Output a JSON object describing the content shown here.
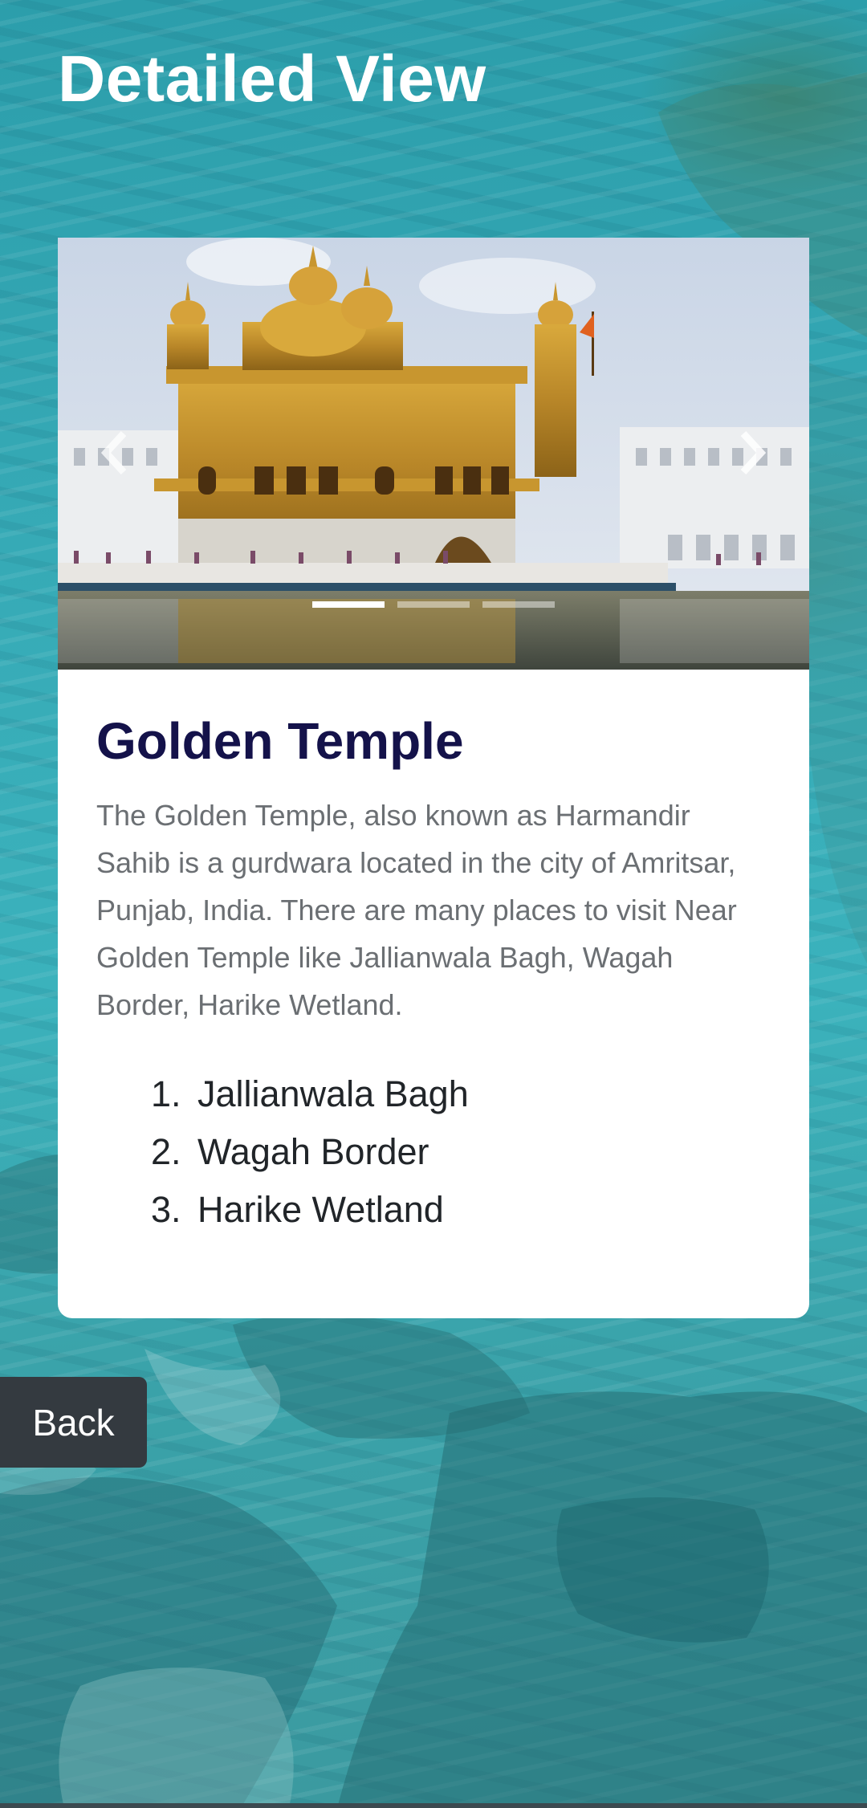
{
  "page": {
    "title": "Detailed View"
  },
  "carousel": {
    "slide_count": 3,
    "active_index": 0,
    "prev_icon": "chevron-left-icon",
    "next_icon": "chevron-right-icon"
  },
  "place": {
    "name": "Golden Temple",
    "description": "The Golden Temple, also known as Harmandir Sahib is a gurdwara located in the city of Amritsar, Punjab, India. There are many places to visit Near Golden Temple like Jallianwala Bagh, Wagah Border, Harike Wetland.",
    "nearby": [
      "Jallianwala Bagh",
      "Wagah Border",
      "Harike Wetland"
    ]
  },
  "actions": {
    "back_label": "Back"
  },
  "colors": {
    "title_text": "#ffffff",
    "place_name": "#14124a",
    "description_text": "#6b6f73",
    "back_button_bg": "#343a40",
    "background_teal": "#36aab6"
  }
}
